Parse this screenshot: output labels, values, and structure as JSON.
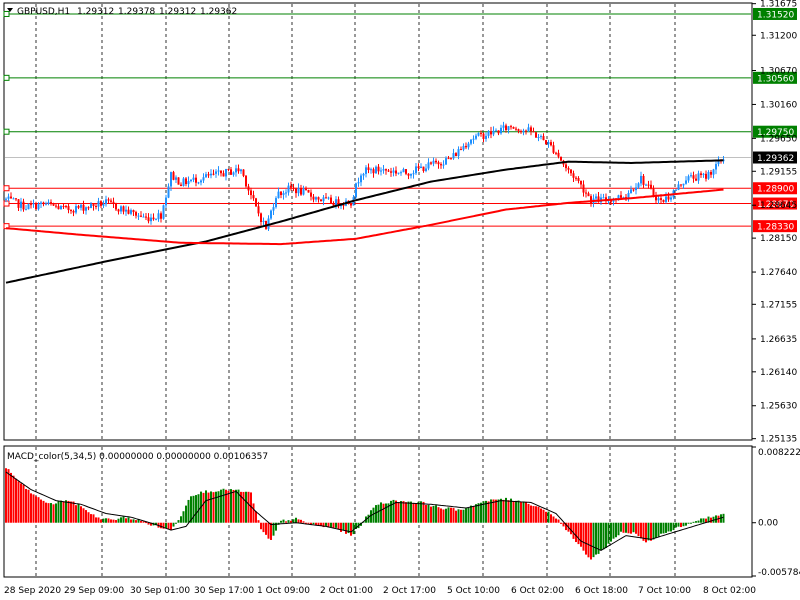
{
  "chart_data": [
    {
      "type": "candlestick",
      "header": {
        "symbol": "GBPUSD,H1",
        "ohlc": [
          "1.29312",
          "1.29378",
          "1.29312",
          "1.29362"
        ]
      },
      "y_ticks": [
        "1.31675",
        "1.31200",
        "1.30670",
        "1.30160",
        "1.29650",
        "1.29155",
        "1.28645",
        "1.28150",
        "1.27640",
        "1.27155",
        "1.26635",
        "1.26140",
        "1.25630",
        "1.25135"
      ],
      "ylim": [
        1.2513,
        1.3167
      ],
      "x_ticks": [
        "28 Sep 2020",
        "29 Sep 09:00",
        "30 Sep 01:00",
        "30 Sep 17:00",
        "1 Oct 09:00",
        "2 Oct 01:00",
        "2 Oct 17:00",
        "5 Oct 10:00",
        "6 Oct 02:00",
        "6 Oct 18:00",
        "7 Oct 10:00",
        "8 Oct 02:00"
      ],
      "current_price": {
        "label": "1.29362",
        "value": 1.29362
      },
      "levels": [
        {
          "label": "1.31520",
          "value": 1.3152,
          "color": "#008000"
        },
        {
          "label": "1.30560",
          "value": 1.3056,
          "color": "#008000"
        },
        {
          "label": "1.29750",
          "value": 1.2975,
          "color": "#008000"
        },
        {
          "label": "1.28900",
          "value": 1.289,
          "color": "#ff0000"
        },
        {
          "label": "1.28670",
          "value": 1.2867,
          "color": "#ff0000"
        },
        {
          "label": "1.28330",
          "value": 1.2833,
          "color": "#ff0000"
        }
      ],
      "close_anchors": [
        [
          0,
          1.2873
        ],
        [
          8,
          1.2862
        ],
        [
          16,
          1.2866
        ],
        [
          24,
          1.2858
        ],
        [
          32,
          1.2862
        ],
        [
          40,
          1.2868
        ],
        [
          48,
          1.2856
        ],
        [
          56,
          1.2845
        ],
        [
          62,
          1.285
        ],
        [
          66,
          1.291
        ],
        [
          70,
          1.2898
        ],
        [
          78,
          1.2905
        ],
        [
          86,
          1.2912
        ],
        [
          94,
          1.2918
        ],
        [
          100,
          1.286
        ],
        [
          104,
          1.283
        ],
        [
          108,
          1.288
        ],
        [
          114,
          1.289
        ],
        [
          120,
          1.2882
        ],
        [
          126,
          1.2873
        ],
        [
          132,
          1.2868
        ],
        [
          138,
          1.287
        ],
        [
          142,
          1.2915
        ],
        [
          150,
          1.2918
        ],
        [
          160,
          1.2913
        ],
        [
          170,
          1.2925
        ],
        [
          178,
          1.2935
        ],
        [
          186,
          1.2965
        ],
        [
          194,
          1.2973
        ],
        [
          202,
          1.2983
        ],
        [
          210,
          1.2975
        ],
        [
          216,
          1.296
        ],
        [
          220,
          1.2945
        ],
        [
          224,
          1.292
        ],
        [
          228,
          1.2905
        ],
        [
          234,
          1.2873
        ],
        [
          240,
          1.2872
        ],
        [
          248,
          1.288
        ],
        [
          254,
          1.2905
        ],
        [
          258,
          1.2885
        ],
        [
          262,
          1.287
        ],
        [
          266,
          1.288
        ],
        [
          272,
          1.2905
        ],
        [
          280,
          1.2908
        ],
        [
          287,
          1.2935
        ]
      ],
      "series": [
        {
          "name": "",
          "color": "#000000",
          "points": [
            [
              0,
              1.2748
            ],
            [
              40,
              1.278
            ],
            [
              80,
              1.281
            ],
            [
              110,
              1.284
            ],
            [
              140,
              1.2872
            ],
            [
              170,
              1.29
            ],
            [
              200,
              1.2918
            ],
            [
              225,
              1.293
            ],
            [
              250,
              1.2928
            ],
            [
              287,
              1.2932
            ]
          ]
        },
        {
          "name": "",
          "color": "#ff0000",
          "points": [
            [
              0,
              1.283
            ],
            [
              30,
              1.282
            ],
            [
              70,
              1.2808
            ],
            [
              110,
              1.2806
            ],
            [
              140,
              1.2814
            ],
            [
              170,
              1.2835
            ],
            [
              200,
              1.2858
            ],
            [
              225,
              1.2868
            ],
            [
              250,
              1.2875
            ],
            [
              287,
              1.2888
            ]
          ]
        }
      ]
    },
    {
      "type": "histogram",
      "title": "MACD_color(5,34,5) 0.00000000 0.00000000 0.00106357",
      "y_ticks": [
        "0.0082226",
        "0.00",
        "-0.0057846"
      ],
      "ylim": [
        -0.0057846,
        0.0082226
      ],
      "anchors": [
        [
          0,
          0.006
        ],
        [
          6,
          0.0042
        ],
        [
          12,
          0.0028
        ],
        [
          18,
          0.002
        ],
        [
          24,
          0.0025
        ],
        [
          30,
          0.0018
        ],
        [
          36,
          0.0006
        ],
        [
          42,
          0.0003
        ],
        [
          48,
          0.0006
        ],
        [
          54,
          0.0002
        ],
        [
          60,
          -0.0004
        ],
        [
          66,
          -0.0008
        ],
        [
          70,
          0.0008
        ],
        [
          74,
          0.003
        ],
        [
          80,
          0.0034
        ],
        [
          90,
          0.0036
        ],
        [
          98,
          0.0032
        ],
        [
          102,
          -0.0008
        ],
        [
          106,
          -0.002
        ],
        [
          110,
          0.0002
        ],
        [
          116,
          0.0004
        ],
        [
          122,
          -0.0002
        ],
        [
          132,
          -0.0006
        ],
        [
          138,
          -0.0014
        ],
        [
          142,
          -0.0002
        ],
        [
          148,
          0.002
        ],
        [
          156,
          0.0024
        ],
        [
          166,
          0.0022
        ],
        [
          174,
          0.0016
        ],
        [
          182,
          0.0014
        ],
        [
          190,
          0.0022
        ],
        [
          198,
          0.0026
        ],
        [
          206,
          0.0024
        ],
        [
          214,
          0.0016
        ],
        [
          220,
          0.0006
        ],
        [
          226,
          -0.0014
        ],
        [
          234,
          -0.004
        ],
        [
          240,
          -0.0026
        ],
        [
          246,
          -0.001
        ],
        [
          252,
          -0.0012
        ],
        [
          256,
          -0.0022
        ],
        [
          262,
          -0.0012
        ],
        [
          270,
          -0.0004
        ],
        [
          278,
          0.0004
        ],
        [
          287,
          0.0009
        ]
      ],
      "signal": [
        [
          0,
          0.0055
        ],
        [
          10,
          0.0036
        ],
        [
          20,
          0.0024
        ],
        [
          30,
          0.002
        ],
        [
          40,
          0.001
        ],
        [
          50,
          0.0006
        ],
        [
          60,
          -0.0002
        ],
        [
          66,
          -0.0008
        ],
        [
          72,
          -0.0004
        ],
        [
          80,
          0.0024
        ],
        [
          92,
          0.0034
        ],
        [
          100,
          0.0012
        ],
        [
          106,
          -0.0002
        ],
        [
          116,
          0.0
        ],
        [
          128,
          -0.0004
        ],
        [
          138,
          -0.001
        ],
        [
          146,
          0.0008
        ],
        [
          156,
          0.0022
        ],
        [
          170,
          0.002
        ],
        [
          184,
          0.0016
        ],
        [
          198,
          0.0024
        ],
        [
          210,
          0.0022
        ],
        [
          220,
          0.001
        ],
        [
          230,
          -0.002
        ],
        [
          238,
          -0.003
        ],
        [
          248,
          -0.0014
        ],
        [
          258,
          -0.0018
        ],
        [
          270,
          -0.0008
        ],
        [
          287,
          0.0006
        ]
      ]
    }
  ]
}
